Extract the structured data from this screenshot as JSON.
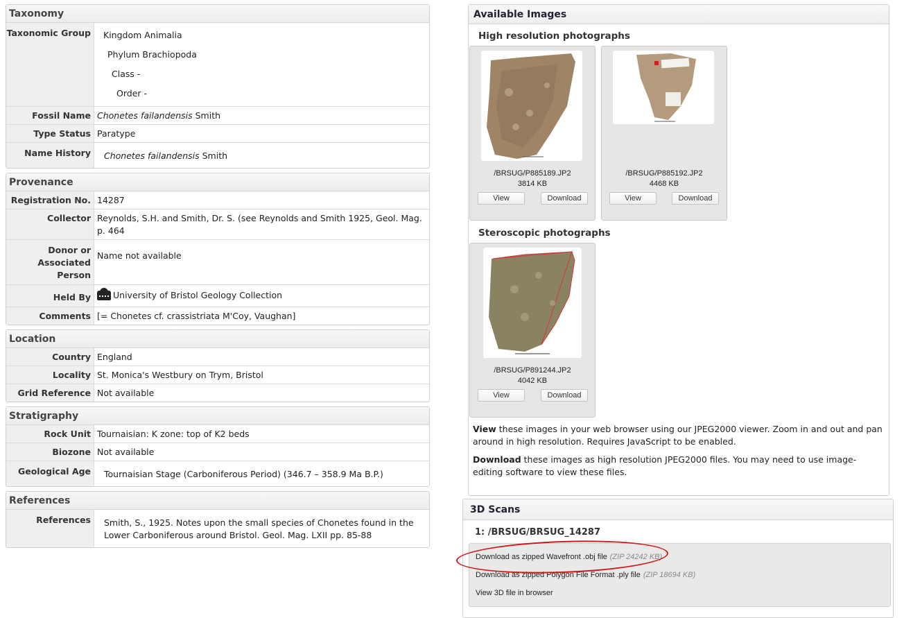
{
  "taxonomy": {
    "title": "Taxonomy",
    "group_label": "Taxonomic Group",
    "kingdom": "Kingdom Animalia",
    "phylum": "Phylum Brachiopoda",
    "class": "Class -",
    "order": "Order -",
    "fossil_name_label": "Fossil Name",
    "fossil_name_italic": "Chonetes failandensis",
    "fossil_name_author": "Smith",
    "type_status_label": "Type Status",
    "type_status": "Paratype",
    "name_history_label": "Name History",
    "name_history_italic": "Chonetes failandensis",
    "name_history_author": "Smith"
  },
  "provenance": {
    "title": "Provenance",
    "reg_label": "Registration No.",
    "reg": "14287",
    "collector_label": "Collector",
    "collector": "Reynolds, S.H. and Smith, Dr. S. (see Reynolds and Smith 1925, Geol. Mag. p. 464",
    "donor_label_1": "Donor or",
    "donor_label_2": "Associated Person",
    "donor": "Name not available",
    "held_label": "Held By",
    "held": "University of Bristol Geology Collection",
    "comments_label": "Comments",
    "comments": "[= Chonetes cf. crassistriata M'Coy, Vaughan]"
  },
  "location": {
    "title": "Location",
    "country_label": "Country",
    "country": "England",
    "locality_label": "Locality",
    "locality": "St. Monica's Westbury on Trym, Bristol",
    "grid_label": "Grid Reference",
    "grid": "Not available"
  },
  "stratigraphy": {
    "title": "Stratigraphy",
    "rock_label": "Rock Unit",
    "rock": "Tournaisian: K zone: top of K2 beds",
    "biozone_label": "Biozone",
    "biozone": "Not available",
    "age_label": "Geological Age",
    "age": "Tournaisian Stage (Carboniferous Period) (346.7 – 358.9 Ma B.P.)"
  },
  "references": {
    "title": "References",
    "label": "References",
    "text": "Smith, S., 1925. Notes upon the small species of Chonetes found in the Lower Carboniferous around Bristol. Geol. Mag. LXII pp. 85-88"
  },
  "images": {
    "title": "Available Images",
    "hires_title": "High resolution photographs",
    "stereo_title": "Steroscopic photographs",
    "items": [
      {
        "file": "/BRSUG/P885189.JP2",
        "size": "3814 KB"
      },
      {
        "file": "/BRSUG/P885192.JP2",
        "size": "4468 KB"
      },
      {
        "file": "/BRSUG/P891244.JP2",
        "size": "4042 KB"
      }
    ],
    "view_label": "View",
    "download_label": "Download",
    "view_desc_bold": "View",
    "view_desc": " these images in your web browser using our JPEG2000 viewer. Zoom in and out and pan around in high resolution. Requires JavaScript to be enabled.",
    "download_desc_bold": "Download",
    "download_desc": " these images as high resolution JPEG2000 files. You may need to use image-editing software to view these files."
  },
  "scans": {
    "title": "3D Scans",
    "item_title": "1: /BRSUG/BRSUG_14287",
    "obj_label": "Download as zipped Wavefront .obj file",
    "obj_meta": "(ZIP 24242 KB)",
    "ply_label": "Download as zipped Polygon File Format .ply file",
    "ply_meta": "(ZIP 18694 KB)",
    "view_label": "View 3D file in browser"
  },
  "annotation_color": "#d01818"
}
